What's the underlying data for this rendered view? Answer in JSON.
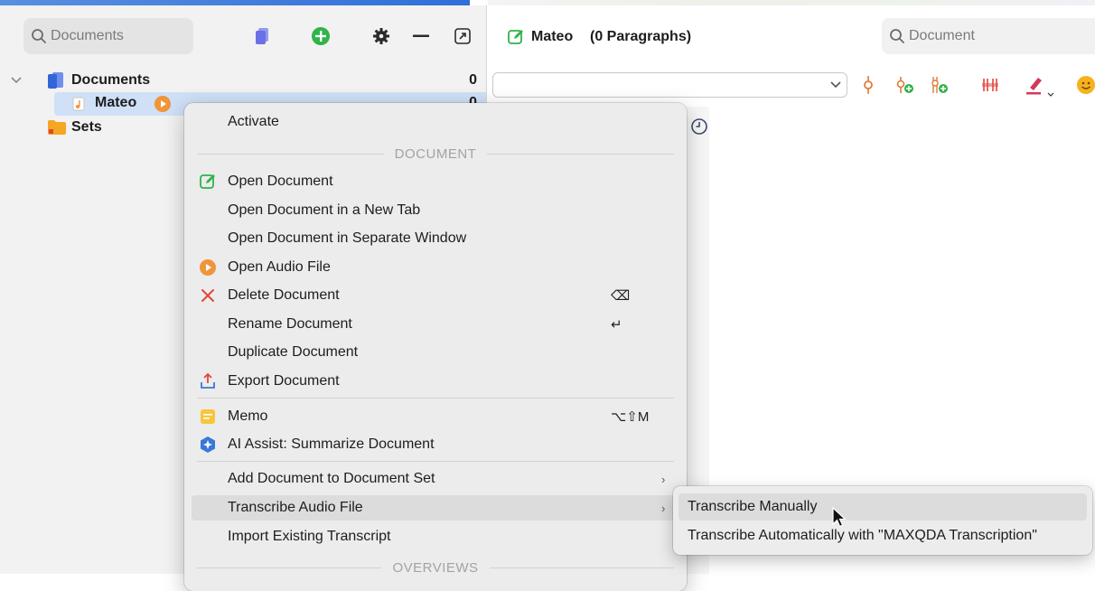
{
  "left_panel": {
    "search_placeholder": "Documents",
    "tree": {
      "root": {
        "label": "Documents",
        "count": "0"
      },
      "child": {
        "label": "Mateo",
        "count": "0"
      },
      "sets": {
        "label": "Sets"
      }
    }
  },
  "right_panel": {
    "title": "Mateo",
    "paragraphs": "(0 Paragraphs)",
    "search_placeholder": "Document"
  },
  "context_menu": {
    "activate": "Activate",
    "section_document": "DOCUMENT",
    "open_document": "Open Document",
    "open_new_tab": "Open Document in a New Tab",
    "open_separate_window": "Open Document in Separate Window",
    "open_audio": "Open Audio File",
    "delete": "Delete Document",
    "delete_shortcut": "⌫",
    "rename": "Rename Document",
    "rename_shortcut": "↵",
    "duplicate": "Duplicate Document",
    "export": "Export Document",
    "memo": "Memo",
    "memo_shortcut": "⌥⇧M",
    "ai_summarize": "AI Assist: Summarize Document",
    "add_to_set": "Add Document to Document Set",
    "transcribe": "Transcribe Audio File",
    "import_transcript": "Import Existing Transcript",
    "section_overviews": "OVERVIEWS",
    "submenu_arrow": "›"
  },
  "submenu": {
    "manual": "Transcribe Manually",
    "auto": "Transcribe Automatically with \"MAXQDA Transcription\""
  },
  "colors": {
    "accent_blue": "#2f6fd8",
    "green": "#2fb34a",
    "orange": "#f0953a",
    "red": "#e0463a",
    "selection": "#cfe0f7"
  }
}
